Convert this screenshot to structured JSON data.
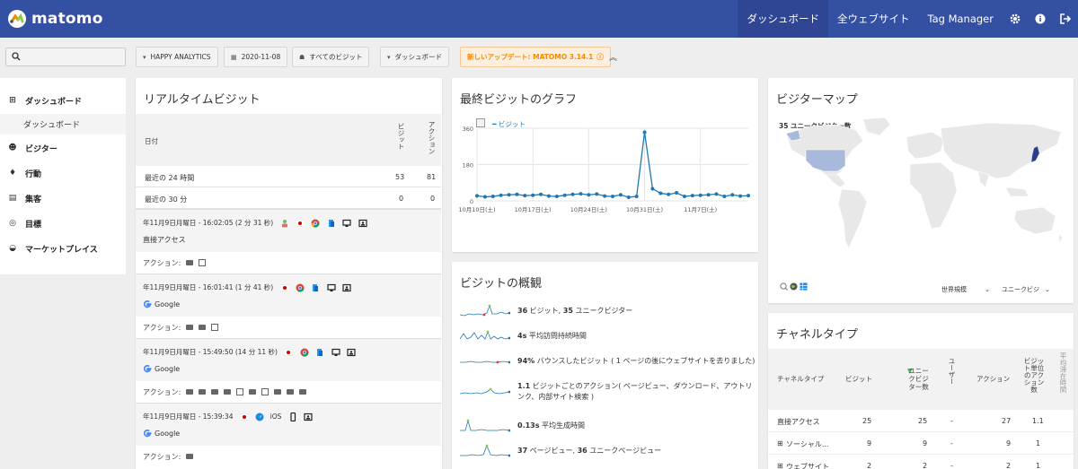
{
  "app": {
    "name": "matomo"
  },
  "topnav": {
    "dashboard": "ダッシュボード",
    "all_websites": "全ウェブサイト",
    "tag_manager": "Tag Manager"
  },
  "filters": {
    "site": "HAPPY ANALYTICS",
    "date": "2020-11-08",
    "segment": "すべてのビジット",
    "dashboard": "ダッシュボード",
    "update": "新しいアップデート: MATOMO 3.14.1"
  },
  "sidebar": {
    "items": [
      {
        "label": "ダッシュボード",
        "icon": "dashboard-icon"
      },
      {
        "label": "ビジター",
        "icon": "visitors-icon"
      },
      {
        "label": "行動",
        "icon": "behaviour-icon"
      },
      {
        "label": "集客",
        "icon": "acquisition-icon"
      },
      {
        "label": "目標",
        "icon": "goals-icon"
      },
      {
        "label": "マーケットプレイス",
        "icon": "marketplace-icon"
      }
    ],
    "sub_item": "ダッシュボード"
  },
  "realtime": {
    "title": "リアルタイムビジット",
    "col_date": "日付",
    "col_visits": "ビジット",
    "col_actions": "アクション",
    "rows": [
      {
        "label": "最近の 24 時間",
        "visits": "53",
        "actions": "81"
      },
      {
        "label": "最近の 30 分",
        "visits": "0",
        "actions": "0"
      }
    ],
    "visits": [
      {
        "time": "年11月9日月曜日 - 16:02:05 (2 分 31 秒)",
        "referrer": "直接アクセス",
        "actions_label": "アクション:"
      },
      {
        "time": "年11月9日月曜日 - 16:01:41 (1 分 41 秒)",
        "referrer": "Google",
        "actions_label": "アクション:"
      },
      {
        "time": "年11月9日月曜日 - 15:49:50 (14 分 11 秒)",
        "referrer": "Google",
        "actions_label": "アクション:"
      },
      {
        "time": "年11月9日月曜日 - 15:39:34",
        "referrer": "Google",
        "actions_label": "アクション:",
        "os": "iOS"
      }
    ]
  },
  "graph": {
    "title": "最終ビジットのグラフ",
    "legend": "ビジット",
    "y_ticks": [
      "360",
      "180",
      "0"
    ],
    "x_ticks": [
      "10月10日(土)",
      "10月17日(土)",
      "10月24日(土)",
      "10月31日(土)",
      "11月7日(土)"
    ]
  },
  "chart_data": {
    "type": "line",
    "series": [
      {
        "name": "ビジット",
        "values": [
          25,
          20,
          22,
          28,
          30,
          32,
          26,
          28,
          32,
          24,
          22,
          28,
          32,
          35,
          30,
          34,
          24,
          22,
          30,
          18,
          22,
          340,
          60,
          38,
          32,
          40,
          22,
          26,
          28,
          30,
          34,
          22,
          30,
          24,
          26
        ]
      }
    ],
    "ylim": [
      0,
      360
    ],
    "x_ticks": [
      "10月10日(土)",
      "10月17日(土)",
      "10月24日(土)",
      "10月31日(土)",
      "11月7日(土)"
    ]
  },
  "overview": {
    "title": "ビジットの概観",
    "rows": [
      {
        "bold": "36",
        "text": " ビジット, ",
        "bold2": "35",
        "text2": " ユニークビジター"
      },
      {
        "bold": "4s",
        "text": " 平均訪問持続時間"
      },
      {
        "bold": "94%",
        "text": " バウンスしたビジット ( 1 ページの後にウェブサイトを去りました)"
      },
      {
        "bold": "1.1",
        "text": " ビジットごとのアクション( ページビュー、ダウンロード、アウトリンク、内部サイト検索 )"
      },
      {
        "bold": "0.13s",
        "text": " 平均生成時間"
      },
      {
        "bold": "37",
        "text": " ページビュー, ",
        "bold2": "36",
        "text2": " ユニークページビュー"
      }
    ]
  },
  "map": {
    "title": "ビジターマップ",
    "unique_label": "35 ユニークビジター数",
    "region_select": "世界規模",
    "metric_select": "ユニークビジ"
  },
  "channel": {
    "title": "チャネルタイプ",
    "headers": [
      "チャネルタイプ",
      "ビジット",
      "ユニークビジター数",
      "ユーザー",
      "アクション",
      "ビジット単位のアクション数",
      "平均滞在時間"
    ],
    "rows": [
      {
        "name": "直接アクセス",
        "visits": "25",
        "unique": "25",
        "users": "-",
        "actions": "27",
        "apv": "1.1"
      },
      {
        "name": "ソーシャル...",
        "visits": "9",
        "unique": "9",
        "users": "-",
        "actions": "9",
        "apv": "1"
      },
      {
        "name": "ウェブサイト",
        "visits": "2",
        "unique": "2",
        "users": "-",
        "actions": "2",
        "apv": "1"
      }
    ]
  },
  "colors": {
    "brand": "#3450a3",
    "line": "#1f78b4",
    "accent_orange": "#f38b00"
  }
}
